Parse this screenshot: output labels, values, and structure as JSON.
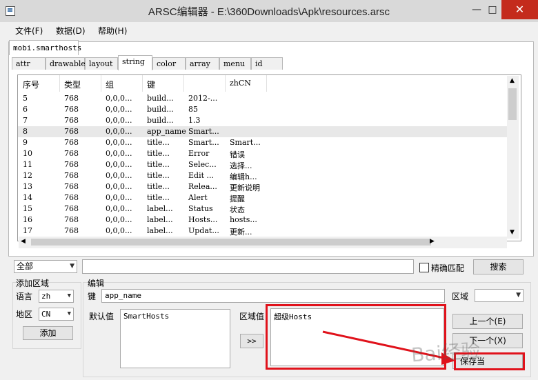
{
  "window": {
    "title": "ARSC编辑器 - E:\\360Downloads\\Apk\\resources.arsc",
    "min": "—",
    "max": "□",
    "close": "✕"
  },
  "menu": [
    "文件(F)",
    "数据(D)",
    "帮助(H)"
  ],
  "package_tab": "mobi.smarthosts",
  "tabs": [
    "attr",
    "drawable",
    "layout",
    "string",
    "color",
    "array",
    "menu",
    "id"
  ],
  "active_tab": "string",
  "table": {
    "headers": [
      "序号",
      "类型",
      "组",
      "键",
      "",
      "zhCN"
    ],
    "rows": [
      [
        "5",
        "768",
        "0,0,0...",
        "build...",
        "2012-...",
        ""
      ],
      [
        "6",
        "768",
        "0,0,0...",
        "build...",
        "85",
        ""
      ],
      [
        "7",
        "768",
        "0,0,0...",
        "build...",
        "1.3",
        ""
      ],
      [
        "8",
        "768",
        "0,0,0...",
        "app_name",
        "Smart...",
        ""
      ],
      [
        "9",
        "768",
        "0,0,0...",
        "title...",
        "Smart...",
        "Smart..."
      ],
      [
        "10",
        "768",
        "0,0,0...",
        "title...",
        "Error",
        "错误"
      ],
      [
        "11",
        "768",
        "0,0,0...",
        "title...",
        "Selec...",
        "选择..."
      ],
      [
        "12",
        "768",
        "0,0,0...",
        "title...",
        "Edit ...",
        "编辑h..."
      ],
      [
        "13",
        "768",
        "0,0,0...",
        "title...",
        "Relea...",
        "更新说明"
      ],
      [
        "14",
        "768",
        "0,0,0...",
        "title...",
        "Alert",
        "提醒"
      ],
      [
        "15",
        "768",
        "0,0,0...",
        "label...",
        "Status",
        "状态"
      ],
      [
        "16",
        "768",
        "0,0,0...",
        "label...",
        "Hosts...",
        "hosts..."
      ],
      [
        "17",
        "768",
        "0,0,0...",
        "label...",
        "Updat...",
        "更新..."
      ]
    ],
    "selected_row_index": 3
  },
  "search": {
    "scope": "全部",
    "query": "",
    "exact_label": "精确匹配",
    "exact_checked": false,
    "button": "搜索"
  },
  "add_region": {
    "title": "添加区域",
    "lang_label": "语言",
    "lang_value": "zh",
    "region_label": "地区",
    "region_value": "CN",
    "add_button": "添加"
  },
  "editor": {
    "title": "编辑",
    "key_label": "键",
    "key_value": "app_name",
    "domain_label": "区域",
    "domain_value": "",
    "default_label": "默认值",
    "default_value": "SmartHosts",
    "copy_button": ">>",
    "region_label": "区域值",
    "region_value": "超级Hosts",
    "prev_button": "上一个(E)",
    "next_button": "下一个(X)",
    "save_button": "保存当"
  },
  "watermark": "Bai经验",
  "colors": {
    "highlight": "#e0121b",
    "selected_row": "#e8e8e8"
  }
}
